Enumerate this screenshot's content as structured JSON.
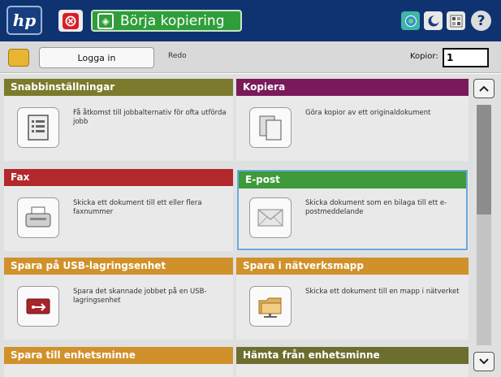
{
  "topbar": {
    "logo_text": "hp",
    "start_label": "Börja kopiering",
    "help_glyph": "?"
  },
  "status": {
    "login_label": "Logga in",
    "status_text": "Redo",
    "copies_label": "Kopior:",
    "copies_value": "1"
  },
  "tiles": [
    {
      "title": "Snabbinställningar",
      "desc": "Få åtkomst till jobbalternativ för ofta utförda jobb",
      "color": "#7c7a2c",
      "icon": "quick-sets-icon"
    },
    {
      "title": "Kopiera",
      "desc": "Göra kopior av ett originaldokument",
      "color": "#7a1a5a",
      "icon": "copy-icon"
    },
    {
      "title": "Fax",
      "desc": "Skicka ett dokument till ett eller flera faxnummer",
      "color": "#b2282d",
      "icon": "fax-icon"
    },
    {
      "title": "E-post",
      "desc": "Skicka dokument som en bilaga till ett e-postmeddelande",
      "color": "#3e9a3a",
      "icon": "email-icon"
    },
    {
      "title": "Spara på USB-lagringsenhet",
      "desc": "Spara det skannade jobbet på en USB-lagringsenhet",
      "color": "#d0912b",
      "icon": "usb-storage-icon"
    },
    {
      "title": "Spara i nätverksmapp",
      "desc": "Skicka ett dokument till en mapp i nätverket",
      "color": "#d0912b",
      "icon": "network-folder-icon"
    },
    {
      "title": "Spara till enhetsminne",
      "desc": "",
      "color": "#d0912b",
      "icon": ""
    },
    {
      "title": "Hämta från enhetsminne",
      "desc": "",
      "color": "#6b6e2e",
      "icon": ""
    }
  ],
  "colors": {
    "topbar": "#0f3370",
    "start": "#2f9e3a",
    "stop": "#d81f26",
    "selection": "#69a8df"
  }
}
